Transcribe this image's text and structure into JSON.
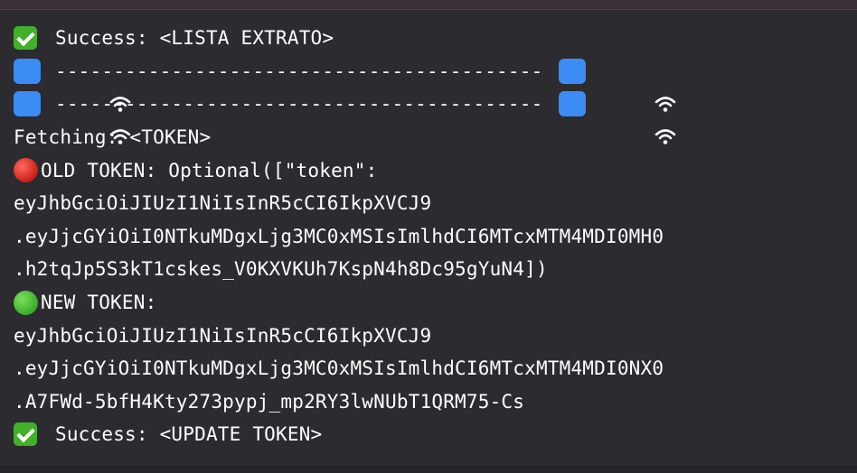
{
  "log": {
    "success_lista": "Success: <LISTA EXTRATO>",
    "dashes_1": "------------------------------------------",
    "dashes_2": "------------------------------------------",
    "fetching": "Fetching: <TOKEN>",
    "old_token_label": "OLD TOKEN: Optional([\"token\":",
    "old_token_line_1": "eyJhbGciOiJIUzI1NiIsInR5cCI6IkpXVCJ9",
    "old_token_line_2": ".eyJjcGYiOiI0NTkuMDgxLjg3MC0xMSIsImlhdCI6MTcxMTM4MDI0MH0",
    "old_token_line_3": ".h2tqJp5S3kT1cskes_V0KXVKUh7KspN4h8Dc95gYuN4])",
    "new_token_label": "NEW TOKEN:",
    "new_token_line_1": "eyJhbGciOiJIUzI1NiIsInR5cCI6IkpXVCJ9",
    "new_token_line_2": ".eyJjcGYiOiI0NTkuMDgxLjg3MC0xMSIsImlhdCI6MTcxMTM4MDI0NX0",
    "new_token_line_3": ".A7FWd-5bfH4Kty273pypj_mp2RY3lwNUbT1QRM75-Cs",
    "success_update": "Success: <UPDATE TOKEN>"
  },
  "icons": {
    "success": "check-mark-icon",
    "network": "wifi-icon",
    "old": "red-circle-icon",
    "new": "green-circle-icon"
  },
  "colors": {
    "background": "#2c2b30",
    "text": "#ffffff",
    "success_green": "#43b02a",
    "wifi_blue": "#3b8cf5",
    "old_red": "#d0241c",
    "new_green": "#3bb22b"
  }
}
